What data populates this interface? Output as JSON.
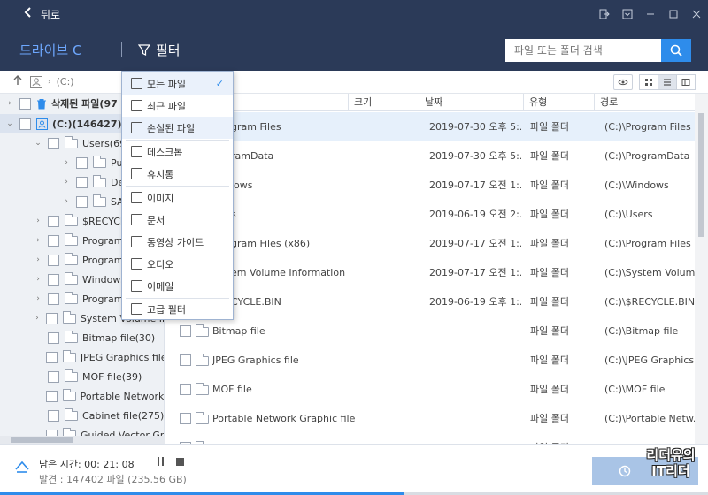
{
  "titlebar": {
    "back_icon": "chevron-left-icon",
    "title": "뒤로"
  },
  "header": {
    "drive_label": "드라이브 C",
    "filter_label": "필터",
    "search_placeholder": "파일 또는 폴더 검색"
  },
  "pathbar": {
    "path": "(C:)"
  },
  "sidebar": {
    "items": [
      {
        "label": "삭제된 파일(97",
        "bold": true
      },
      {
        "label": "(C:)(146427)",
        "bold": true
      },
      {
        "label": "Users(6949"
      },
      {
        "label": "Pub"
      },
      {
        "label": "Def"
      },
      {
        "label": "SA"
      },
      {
        "label": "$RECYCLE.B"
      },
      {
        "label": "Program F"
      },
      {
        "label": "ProgramD"
      },
      {
        "label": "Windows(9"
      },
      {
        "label": "Program F"
      },
      {
        "label": "System Volume Inforn"
      },
      {
        "label": "Bitmap file(30)"
      },
      {
        "label": "JPEG Graphics file(38)"
      },
      {
        "label": "MOF file(39)"
      },
      {
        "label": "Portable Network Grap"
      },
      {
        "label": "Cabinet file(275)"
      },
      {
        "label": "Guided Vector Graphi"
      }
    ]
  },
  "table": {
    "columns": {
      "size": "크기",
      "date": "날짜",
      "type": "유형",
      "path": "경로"
    },
    "rows": [
      {
        "name": "gram Files",
        "date": "2019-07-30 오후 5:...",
        "type": "파일 폴더",
        "path": "(C:)\\Program Files"
      },
      {
        "name": "ramData",
        "date": "2019-07-30 오후 5:...",
        "type": "파일 폴더",
        "path": "(C:)\\ProgramData"
      },
      {
        "name": "lows",
        "date": "2019-07-17 오전 1:...",
        "type": "파일 폴더",
        "path": "(C:)\\Windows"
      },
      {
        "name": "s",
        "date": "2019-06-19 오전 2:...",
        "type": "파일 폴더",
        "path": "(C:)\\Users"
      },
      {
        "name": "gram Files (x86)",
        "date": "2019-07-17 오전 1:...",
        "type": "파일 폴더",
        "path": "(C:)\\Program Files (..."
      },
      {
        "name": "em Volume Information",
        "date": "2019-07-17 오전 1:...",
        "type": "파일 폴더",
        "path": "(C:)\\System Volum..."
      },
      {
        "name": "CYCLE.BIN",
        "date": "2019-06-19 오후 1:...",
        "type": "파일 폴더",
        "path": "(C:)\\$RECYCLE.BIN"
      },
      {
        "name": "Bitmap file",
        "date": "",
        "type": "파일 폴더",
        "path": "(C:)\\Bitmap file"
      },
      {
        "name": "JPEG Graphics file",
        "date": "",
        "type": "파일 폴더",
        "path": "(C:)\\JPEG Graphics ..."
      },
      {
        "name": "MOF file",
        "date": "",
        "type": "파일 폴더",
        "path": "(C:)\\MOF file"
      },
      {
        "name": "Portable Network Graphic file",
        "date": "",
        "type": "파일 폴더",
        "path": "(C:)\\Portable Netw..."
      },
      {
        "name": "Cabinet file",
        "date": "",
        "type": "파일 폴더",
        "path": "(C:)\\Cabinet file"
      }
    ]
  },
  "filter_menu": {
    "items": [
      {
        "label": "모든 파일",
        "icon": "file-icon",
        "checked": true
      },
      {
        "label": "최근 파일",
        "icon": "recent-file-icon"
      },
      {
        "label": "손실된 파일",
        "icon": "lost-file-icon"
      },
      {
        "label": "데스크톱",
        "icon": "desktop-icon"
      },
      {
        "label": "휴지통",
        "icon": "trash-icon"
      },
      {
        "label": "이미지",
        "icon": "image-icon"
      },
      {
        "label": "문서",
        "icon": "document-icon"
      },
      {
        "label": "동영상 가이드",
        "icon": "video-icon"
      },
      {
        "label": "오디오",
        "icon": "audio-icon"
      },
      {
        "label": "이메일",
        "icon": "email-icon"
      },
      {
        "label": "고급 필터",
        "icon": "sliders-icon"
      }
    ],
    "check_mark": "✓"
  },
  "footer": {
    "time_remaining": "남은 시간: 00: 21: 08",
    "found": "발견 : 147402 파일 (235.56 GB)",
    "progress": 0.57
  },
  "watermark": {
    "line1": "리더유의",
    "line2": "IT리더"
  },
  "colors": {
    "header_bg": "#2b3a58",
    "accent": "#2e8ceb",
    "drive_text": "#6ea8ff"
  }
}
